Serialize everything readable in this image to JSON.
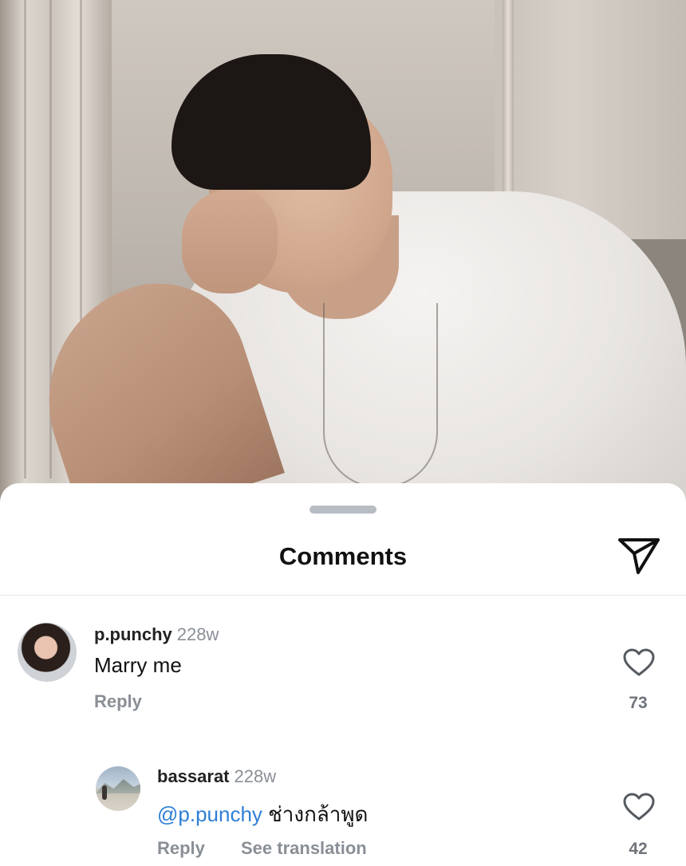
{
  "sheet": {
    "title": "Comments"
  },
  "comments": [
    {
      "username": "p.punchy",
      "time": "228w",
      "text": "Marry me",
      "reply_label": "Reply",
      "likes": "73"
    }
  ],
  "replies": [
    {
      "username": "bassarat",
      "time": "228w",
      "mention": "@p.punchy",
      "text": "ช่างกล้าพูด",
      "reply_label": "Reply",
      "translate_label": "See translation",
      "likes": "42"
    }
  ],
  "colors": {
    "mention": "#2f7fd6",
    "meta": "#8a8f96",
    "handle": "#b8bcc3"
  },
  "icons": [
    "send-icon",
    "heart-icon"
  ]
}
